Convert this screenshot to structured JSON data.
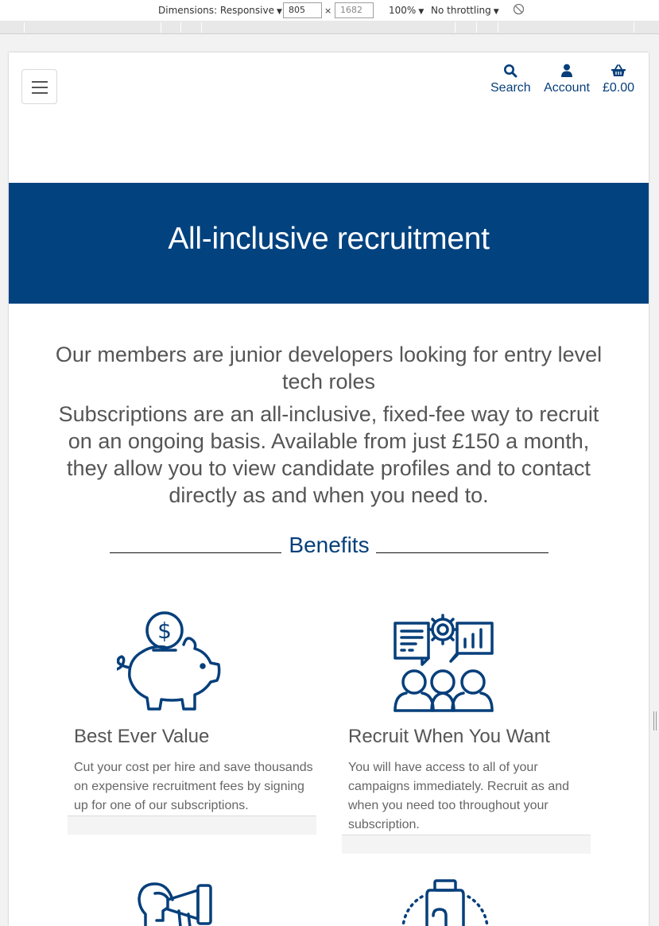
{
  "devtools": {
    "dimensions_label": "Dimensions: Responsive",
    "width": "805",
    "height": "1682",
    "zoom": "100%",
    "throttling": "No throttling"
  },
  "header": {
    "search_label": "Search",
    "account_label": "Account",
    "basket_total": "£0.00"
  },
  "hero": {
    "title": "All-inclusive recruitment"
  },
  "intro": {
    "lead": "Our members are junior developers looking for entry level tech roles",
    "body": "Subscriptions are an all-inclusive, fixed-fee way to recruit on an ongoing basis. Available from just £150 a month, they allow you to view candidate profiles and to contact directly as and when you need to."
  },
  "benefits": {
    "heading": "Benefits",
    "items": [
      {
        "icon": "piggy-bank-icon",
        "title": "Best Ever Value",
        "text": "Cut your cost per hire and save thousands on expensive recruitment fees by signing up for one of our subscriptions."
      },
      {
        "icon": "team-presentation-icon",
        "title": "Recruit When You Want",
        "text": "You will have access to all of your campaigns immediately. Recruit as and when you need too throughout your subscription."
      },
      {
        "icon": "megaphone-person-icon"
      },
      {
        "icon": "hand-badge-icon"
      }
    ]
  },
  "colors": {
    "brand_blue": "#01427f",
    "link_blue": "#063f7b",
    "text_grey": "#555555"
  }
}
